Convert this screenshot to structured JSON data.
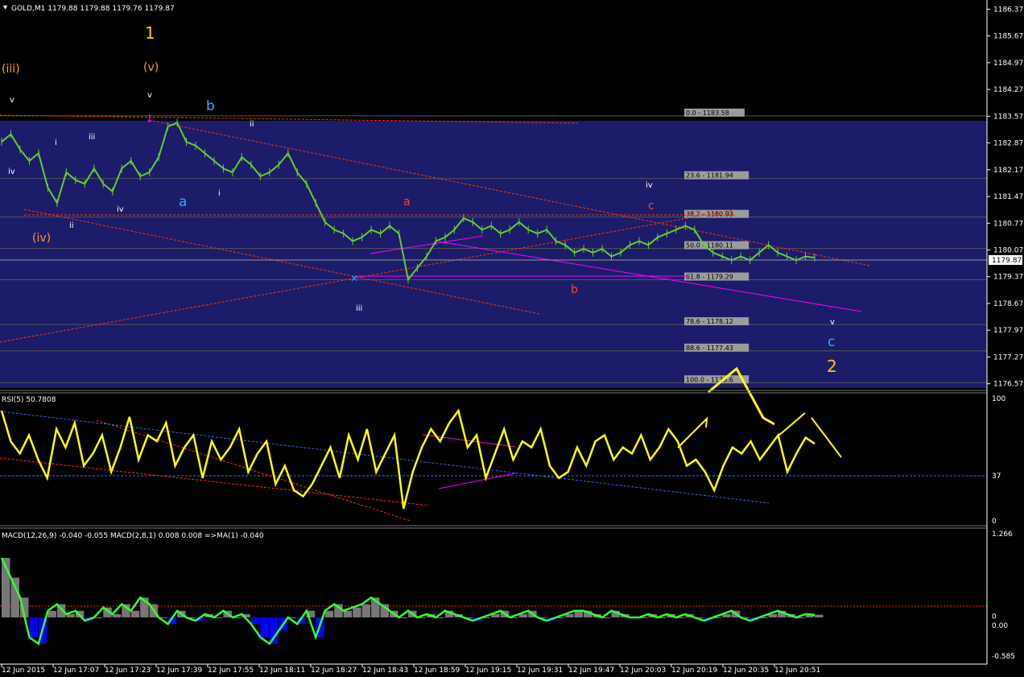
{
  "header": {
    "symbol_info": "GOLD,M1  1179.88 1179.88 1179.76 1179.87",
    "rsi_info": "RSI(5) 50.7808",
    "macd_info": "MACD(12,26,9) -0.040 -0.055  MACD(2,8,1) 0.008 0.008  =>MA(1) -0.040"
  },
  "colors": {
    "background": "#000000",
    "fib_zone": "#1c1c6b",
    "price_line": "#66cc33",
    "rsi_line": "#ffff00",
    "macd_line": "#33ff33",
    "macd_hist_blue": "#0000ff",
    "trend_red": "#ff3300",
    "trend_magenta": "#ff00ff",
    "axis_text": "#ffffff"
  },
  "chart_data": [
    {
      "type": "line",
      "title": "GOLD,M1",
      "ylim": [
        1176.5,
        1186.4
      ],
      "y_ticks": [
        "1186.37",
        "1185.67",
        "1184.97",
        "1184.27",
        "1183.57",
        "1182.87",
        "1182.17",
        "1181.47",
        "1180.77",
        "1180.07",
        "1179.37",
        "1178.67",
        "1177.97",
        "1177.27",
        "1176.57"
      ],
      "current_price": "1179.87",
      "x_ticks": [
        "12 Jun 2015",
        "12 Jun 17:07",
        "12 Jun 17:23",
        "12 Jun 17:39",
        "12 Jun 17:55",
        "12 Jun 18:11",
        "12 Jun 18:27",
        "12 Jun 18:43",
        "12 Jun 18:59",
        "12 Jun 19:15",
        "12 Jun 19:31",
        "12 Jun 19:47",
        "12 Jun 20:03",
        "12 Jun 20:19",
        "12 Jun 20:35",
        "12 Jun 20:51"
      ],
      "series": [
        {
          "values": [
            1182.9,
            1183.1,
            1182.7,
            1182.4,
            1182.6,
            1181.7,
            1181.3,
            1182.1,
            1181.9,
            1181.8,
            1182.2,
            1181.8,
            1181.6,
            1182.2,
            1182.4,
            1182.0,
            1182.1,
            1182.5,
            1183.3,
            1183.4,
            1182.9,
            1182.8,
            1182.6,
            1182.4,
            1182.2,
            1182.1,
            1182.5,
            1182.3,
            1182.0,
            1182.1,
            1182.3,
            1182.6,
            1182.1,
            1181.8,
            1181.3,
            1180.8,
            1180.6,
            1180.5,
            1180.3,
            1180.4,
            1180.6,
            1180.5,
            1180.7,
            1180.5,
            1179.3,
            1179.6,
            1179.9,
            1180.3,
            1180.4,
            1180.6,
            1180.9,
            1180.8,
            1180.6,
            1180.7,
            1180.5,
            1180.6,
            1180.8,
            1180.6,
            1180.5,
            1180.6,
            1180.3,
            1180.2,
            1180.0,
            1180.1,
            1180.0,
            1180.1,
            1179.9,
            1180.0,
            1180.2,
            1180.3,
            1180.2,
            1180.4,
            1180.5,
            1180.6,
            1180.7,
            1180.6,
            1180.2,
            1180.0,
            1179.9,
            1179.8,
            1179.9,
            1179.8,
            1180.0,
            1180.2,
            1180.0,
            1179.9,
            1179.8,
            1179.9,
            1179.87
          ]
        }
      ],
      "fib_levels": [
        {
          "label": "0.0 - 1183.58",
          "value": 1183.58
        },
        {
          "label": "23.6 - 1181.94",
          "value": 1181.94
        },
        {
          "label": "38.2 - 1180.93",
          "value": 1180.93
        },
        {
          "label": "50.0 - 1180.11",
          "value": 1180.11
        },
        {
          "label": "61.8 - 1179.29",
          "value": 1179.29
        },
        {
          "label": "78.6 - 1178.12",
          "value": 1178.12
        },
        {
          "label": "88.6 - 1177.43",
          "value": 1177.43
        },
        {
          "label": "100.0 - 1176.6",
          "value": 1176.6
        }
      ],
      "wave_labels": [
        "1",
        "(v)",
        "(iii)",
        "v",
        "v",
        "b",
        "ii",
        "i",
        "iii",
        "iv",
        "a",
        "i",
        "iv",
        "ii",
        "(iv)",
        "a",
        "c",
        "iv",
        "b",
        "iii",
        "v",
        "c",
        "2"
      ]
    },
    {
      "type": "line",
      "title": "RSI(5) 50.7808",
      "ylim": [
        0,
        100
      ],
      "y_ticks": [
        "100",
        "37",
        "0"
      ],
      "series": [
        {
          "values": [
            90,
            65,
            55,
            70,
            50,
            35,
            75,
            60,
            80,
            45,
            55,
            70,
            40,
            60,
            85,
            50,
            70,
            65,
            80,
            45,
            60,
            70,
            35,
            65,
            50,
            60,
            75,
            40,
            55,
            65,
            30,
            45,
            25,
            20,
            30,
            45,
            60,
            35,
            70,
            50,
            75,
            40,
            55,
            70,
            10,
            40,
            60,
            75,
            65,
            80,
            90,
            60,
            70,
            35,
            55,
            75,
            50,
            65,
            60,
            75,
            45,
            35,
            40,
            60,
            45,
            65,
            70,
            50,
            60,
            55,
            70,
            50,
            60,
            75,
            65,
            45,
            50,
            40,
            25,
            45,
            60,
            55,
            65,
            50,
            60,
            70,
            40,
            55,
            68,
            63
          ]
        }
      ]
    },
    {
      "type": "bar",
      "title": "MACD(12,26,9) -0.040 -0.055  MACD(2,8,1) 0.008 0.008  =>MA(1) -0.040",
      "ylim": [
        -0.585,
        1.266
      ],
      "y_ticks": [
        "1.266",
        "0",
        "0.00",
        "-0.585"
      ],
      "series": [
        {
          "values": [
            0.9,
            0.6,
            0.3,
            -0.3,
            -0.4,
            0.1,
            0.2,
            0.05,
            0.1,
            -0.05,
            0.0,
            0.15,
            0.05,
            0.2,
            0.1,
            0.3,
            0.2,
            0.0,
            -0.1,
            0.1,
            0.0,
            -0.05,
            0.05,
            0.0,
            0.1,
            0.0,
            0.05,
            -0.1,
            -0.3,
            -0.4,
            -0.2,
            0.0,
            -0.1,
            0.1,
            -0.3,
            0.1,
            0.2,
            0.1,
            0.15,
            0.2,
            0.3,
            0.2,
            0.1,
            0.0,
            0.1,
            0.0,
            0.05,
            0.0,
            0.1,
            0.05,
            0.0,
            -0.05,
            0.0,
            0.05,
            0.1,
            0.0,
            0.05,
            0.1,
            0.0,
            -0.05,
            0.0,
            0.05,
            0.1,
            0.1,
            0.05,
            0.0,
            0.1,
            0.05,
            0.0,
            0.0,
            0.05,
            0.0,
            0.05,
            0.0,
            0.05,
            0.0,
            -0.05,
            0.0,
            0.05,
            0.1,
            0.0,
            -0.05,
            0.0,
            0.05,
            0.1,
            0.05,
            0.0,
            0.05,
            0.04
          ]
        }
      ]
    }
  ]
}
